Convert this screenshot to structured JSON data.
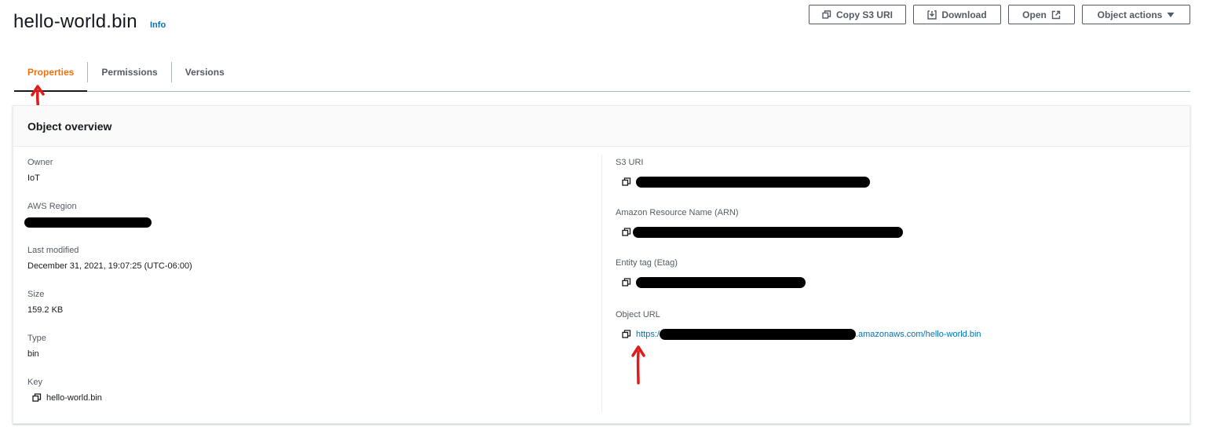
{
  "header": {
    "title": "hello-world.bin",
    "info_label": "Info",
    "buttons": {
      "copy_uri": "Copy S3 URI",
      "download": "Download",
      "open": "Open",
      "object_actions": "Object actions"
    }
  },
  "tabs": [
    {
      "label": "Properties",
      "active": true
    },
    {
      "label": "Permissions",
      "active": false
    },
    {
      "label": "Versions",
      "active": false
    }
  ],
  "overview": {
    "title": "Object overview",
    "left": {
      "owner_label": "Owner",
      "owner_value": "IoT",
      "region_label": "AWS Region",
      "modified_label": "Last modified",
      "modified_value": "December 31, 2021, 19:07:25 (UTC-06:00)",
      "size_label": "Size",
      "size_value": "159.2 KB",
      "type_label": "Type",
      "type_value": "bin",
      "key_label": "Key",
      "key_value": "hello-world.bin"
    },
    "right": {
      "s3uri_label": "S3 URI",
      "arn_label": "Amazon Resource Name (ARN)",
      "etag_label": "Entity tag (Etag)",
      "url_label": "Object URL",
      "url_prefix": "https:/",
      "url_suffix": ".amazonaws.com/hello-world.bin"
    }
  },
  "colors": {
    "accent": "#ec7211",
    "link": "#0073bb",
    "annotation": "#e01b1b"
  },
  "icons": {
    "copy": "copy-icon",
    "download": "download-icon",
    "external": "external-link-icon",
    "caret": "caret-down-icon"
  }
}
